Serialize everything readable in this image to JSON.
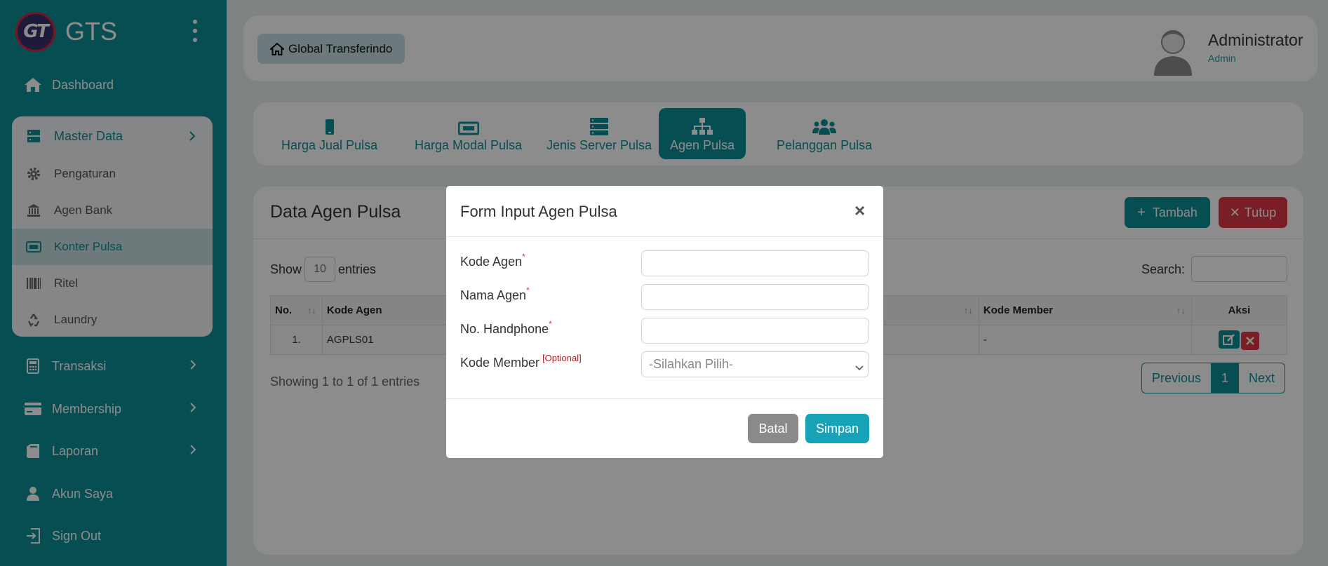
{
  "app": {
    "brand_name": "GTS",
    "logo_text": "GT"
  },
  "sidebar": {
    "dashboard": "Dashboard",
    "master_data": {
      "label": "Master Data",
      "items": [
        {
          "label": "Pengaturan",
          "icon": "gear-icon"
        },
        {
          "label": "Agen Bank",
          "icon": "bank-icon"
        },
        {
          "label": "Konter Pulsa",
          "icon": "ticket-icon",
          "active": true
        },
        {
          "label": "Ritel",
          "icon": "barcode-icon"
        },
        {
          "label": "Laundry",
          "icon": "recycle-icon"
        }
      ]
    },
    "transaksi": "Transaksi",
    "membership": "Membership",
    "laporan": "Laporan",
    "akun_saya": "Akun Saya",
    "sign_out": "Sign Out"
  },
  "topbar": {
    "breadcrumb": "Global Transferindo",
    "user_name": "Administrator",
    "user_role": "Admin"
  },
  "tabs": [
    {
      "label": "Harga Jual Pulsa",
      "icon": "mobile-icon"
    },
    {
      "label": "Harga Modal Pulsa",
      "icon": "ticket-icon"
    },
    {
      "label": "Jenis Server Pulsa",
      "icon": "server-icon"
    },
    {
      "label": "Agen Pulsa",
      "icon": "sitemap-icon",
      "active": true
    },
    {
      "label": "Pelanggan Pulsa",
      "icon": "users-icon"
    }
  ],
  "content": {
    "title": "Data Agen Pulsa",
    "btn_tambah": "Tambah",
    "btn_tutup": "Tutup",
    "show": "Show",
    "length": "10",
    "entries": "entries",
    "search_label": "Search:",
    "columns": {
      "no": "No.",
      "kode_agen": "Kode Agen",
      "kode_member": "Kode Member",
      "aksi": "Aksi"
    },
    "rows": [
      {
        "no": "1.",
        "kode_agen": "AGPLS01",
        "kode_member": "-"
      }
    ],
    "info": "Showing 1 to 1 of 1 entries",
    "pager": {
      "previous": "Previous",
      "current": "1",
      "next": "Next"
    }
  },
  "modal": {
    "title": "Form Input Agen Pulsa",
    "close": "×",
    "fields": {
      "kode_agen": "Kode Agen",
      "nama_agen": "Nama Agen",
      "no_handphone": "No. Handphone",
      "kode_member": "Kode Member"
    },
    "required_mark": "*",
    "optional_mark": "[Optional]",
    "select_placeholder": "-Silahkan Pilih-",
    "btn_batal": "Batal",
    "btn_simpan": "Simpan"
  },
  "colors": {
    "primary": "#0e8e96",
    "danger": "#dc3545",
    "info": "#17a2b8",
    "secondary": "#8a8a8a"
  }
}
